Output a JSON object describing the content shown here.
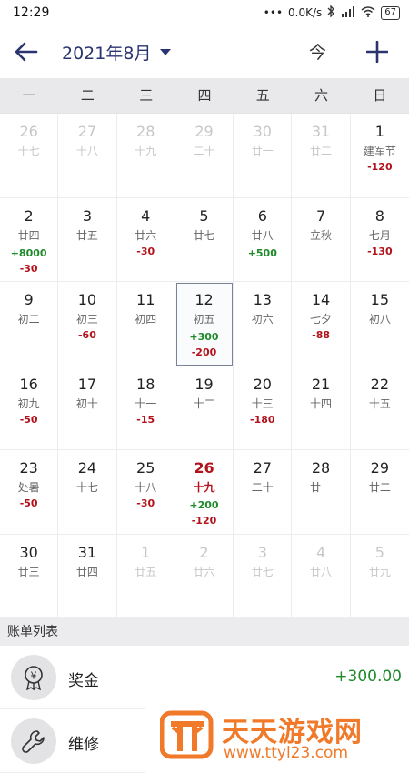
{
  "status_bar": {
    "time": "12:29",
    "speed": "0.0K/s",
    "battery": "67"
  },
  "app_bar": {
    "title": "2021年8月",
    "today_label": "今",
    "icons": {
      "back": "arrow-left-icon",
      "dropdown": "triangle-down-icon",
      "add": "plus-icon"
    },
    "accent_color": "#2a3570"
  },
  "weekdays": [
    "一",
    "二",
    "三",
    "四",
    "五",
    "六",
    "日"
  ],
  "calendar": {
    "days": [
      {
        "num": "26",
        "lunar": "十七",
        "inc": "",
        "exp": "",
        "state": "other"
      },
      {
        "num": "27",
        "lunar": "十八",
        "inc": "",
        "exp": "",
        "state": "other"
      },
      {
        "num": "28",
        "lunar": "十九",
        "inc": "",
        "exp": "",
        "state": "other"
      },
      {
        "num": "29",
        "lunar": "二十",
        "inc": "",
        "exp": "",
        "state": "other"
      },
      {
        "num": "30",
        "lunar": "廿一",
        "inc": "",
        "exp": "",
        "state": "other"
      },
      {
        "num": "31",
        "lunar": "廿二",
        "inc": "",
        "exp": "",
        "state": "other"
      },
      {
        "num": "1",
        "lunar": "建军节",
        "inc": "",
        "exp": "-120",
        "state": ""
      },
      {
        "num": "2",
        "lunar": "廿四",
        "inc": "+8000",
        "exp": "-30",
        "state": ""
      },
      {
        "num": "3",
        "lunar": "廿五",
        "inc": "",
        "exp": "",
        "state": ""
      },
      {
        "num": "4",
        "lunar": "廿六",
        "inc": "",
        "exp": "-30",
        "state": ""
      },
      {
        "num": "5",
        "lunar": "廿七",
        "inc": "",
        "exp": "",
        "state": ""
      },
      {
        "num": "6",
        "lunar": "廿八",
        "inc": "+500",
        "exp": "",
        "state": ""
      },
      {
        "num": "7",
        "lunar": "立秋",
        "inc": "",
        "exp": "",
        "state": ""
      },
      {
        "num": "8",
        "lunar": "七月",
        "inc": "",
        "exp": "-130",
        "state": ""
      },
      {
        "num": "9",
        "lunar": "初二",
        "inc": "",
        "exp": "",
        "state": ""
      },
      {
        "num": "10",
        "lunar": "初三",
        "inc": "",
        "exp": "-60",
        "state": ""
      },
      {
        "num": "11",
        "lunar": "初四",
        "inc": "",
        "exp": "",
        "state": ""
      },
      {
        "num": "12",
        "lunar": "初五",
        "inc": "+300",
        "exp": "-200",
        "state": "selected"
      },
      {
        "num": "13",
        "lunar": "初六",
        "inc": "",
        "exp": "",
        "state": ""
      },
      {
        "num": "14",
        "lunar": "七夕",
        "inc": "",
        "exp": "-88",
        "state": ""
      },
      {
        "num": "15",
        "lunar": "初八",
        "inc": "",
        "exp": "",
        "state": ""
      },
      {
        "num": "16",
        "lunar": "初九",
        "inc": "",
        "exp": "-50",
        "state": ""
      },
      {
        "num": "17",
        "lunar": "初十",
        "inc": "",
        "exp": "",
        "state": ""
      },
      {
        "num": "18",
        "lunar": "十一",
        "inc": "",
        "exp": "-15",
        "state": ""
      },
      {
        "num": "19",
        "lunar": "十二",
        "inc": "",
        "exp": "",
        "state": ""
      },
      {
        "num": "20",
        "lunar": "十三",
        "inc": "",
        "exp": "-180",
        "state": ""
      },
      {
        "num": "21",
        "lunar": "十四",
        "inc": "",
        "exp": "",
        "state": ""
      },
      {
        "num": "22",
        "lunar": "十五",
        "inc": "",
        "exp": "",
        "state": ""
      },
      {
        "num": "23",
        "lunar": "处暑",
        "inc": "",
        "exp": "-50",
        "state": ""
      },
      {
        "num": "24",
        "lunar": "十七",
        "inc": "",
        "exp": "",
        "state": ""
      },
      {
        "num": "25",
        "lunar": "十八",
        "inc": "",
        "exp": "-30",
        "state": ""
      },
      {
        "num": "26",
        "lunar": "十九",
        "inc": "+200",
        "exp": "-120",
        "state": "today"
      },
      {
        "num": "27",
        "lunar": "二十",
        "inc": "",
        "exp": "",
        "state": ""
      },
      {
        "num": "28",
        "lunar": "廿一",
        "inc": "",
        "exp": "",
        "state": ""
      },
      {
        "num": "29",
        "lunar": "廿二",
        "inc": "",
        "exp": "",
        "state": ""
      },
      {
        "num": "30",
        "lunar": "廿三",
        "inc": "",
        "exp": "",
        "state": ""
      },
      {
        "num": "31",
        "lunar": "廿四",
        "inc": "",
        "exp": "",
        "state": ""
      },
      {
        "num": "1",
        "lunar": "廿五",
        "inc": "",
        "exp": "",
        "state": "other"
      },
      {
        "num": "2",
        "lunar": "廿六",
        "inc": "",
        "exp": "",
        "state": "other"
      },
      {
        "num": "3",
        "lunar": "廿七",
        "inc": "",
        "exp": "",
        "state": "other"
      },
      {
        "num": "4",
        "lunar": "廿八",
        "inc": "",
        "exp": "",
        "state": "other"
      },
      {
        "num": "5",
        "lunar": "廿九",
        "inc": "",
        "exp": "",
        "state": "other"
      }
    ]
  },
  "bill_list": {
    "header": "账单列表",
    "items": [
      {
        "name": "奖金",
        "amount": "+300.00",
        "icon": "bonus-medal-icon"
      },
      {
        "name": "维修",
        "amount": "",
        "icon": "wrench-icon"
      }
    ]
  },
  "watermark": {
    "title": "天天游戏网",
    "url": "www.ttyl23.com"
  },
  "colors": {
    "income": "#1f8a2a",
    "expense": "#b2121b",
    "header_bg": "#e9e9eb",
    "watermark": "#f07a2a"
  }
}
